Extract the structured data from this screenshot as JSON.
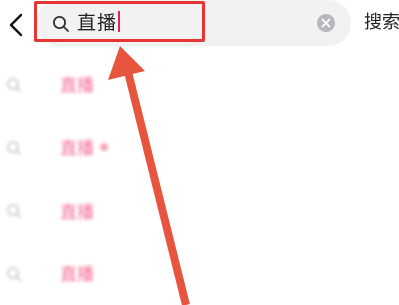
{
  "header": {
    "back_icon": "chevron-left-icon",
    "search_icon": "search-icon",
    "search_value": "直播",
    "clear_icon": "clear-circle-icon",
    "search_button_label": "搜索"
  },
  "suggestions": [
    {
      "keyword": "直播",
      "rest": "",
      "hot": false
    },
    {
      "keyword": "直播",
      "rest": "",
      "hot": true
    },
    {
      "keyword": "直播",
      "rest": "",
      "hot": false
    },
    {
      "keyword": "直播",
      "rest": "",
      "hot": false
    }
  ],
  "annotation": {
    "highlight_color": "#e53535",
    "arrow_color": "#e8553f"
  },
  "colors": {
    "keyword_highlight": "#f4698f",
    "caret": "#e0245e",
    "search_bar_bg": "#f2f2f3"
  }
}
